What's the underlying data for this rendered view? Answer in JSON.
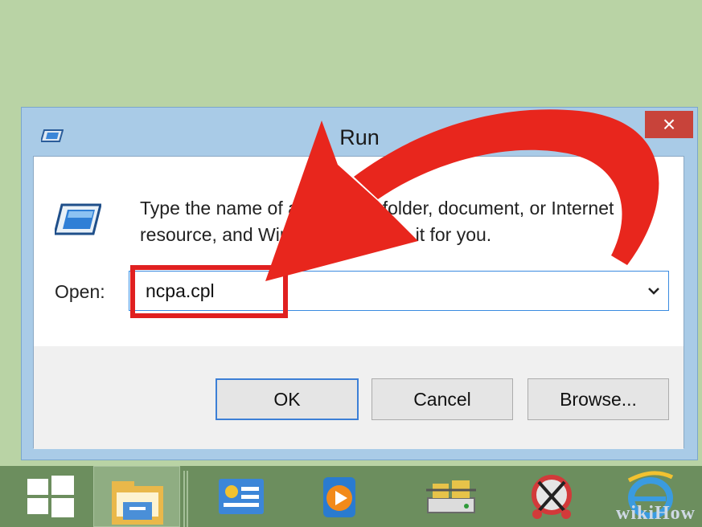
{
  "dialog": {
    "title": "Run",
    "close_glyph": "×",
    "description": "Type the name of a program, folder, document, or Internet\nresource, and Windows will open it for you.",
    "open_label": "Open:",
    "open_value": "ncpa.cpl",
    "buttons": {
      "ok": "OK",
      "cancel": "Cancel",
      "browse": "Browse..."
    }
  },
  "taskbar": {
    "items": [
      "start-windows-icon",
      "file-explorer-icon",
      "control-panel-icon",
      "media-player-icon",
      "network-connections-icon",
      "snipping-tool-icon",
      "internet-explorer-icon"
    ]
  },
  "annotation": {
    "arrow_color": "#e8261d",
    "highlight_color": "#e02020"
  },
  "watermark": "wikiHow"
}
